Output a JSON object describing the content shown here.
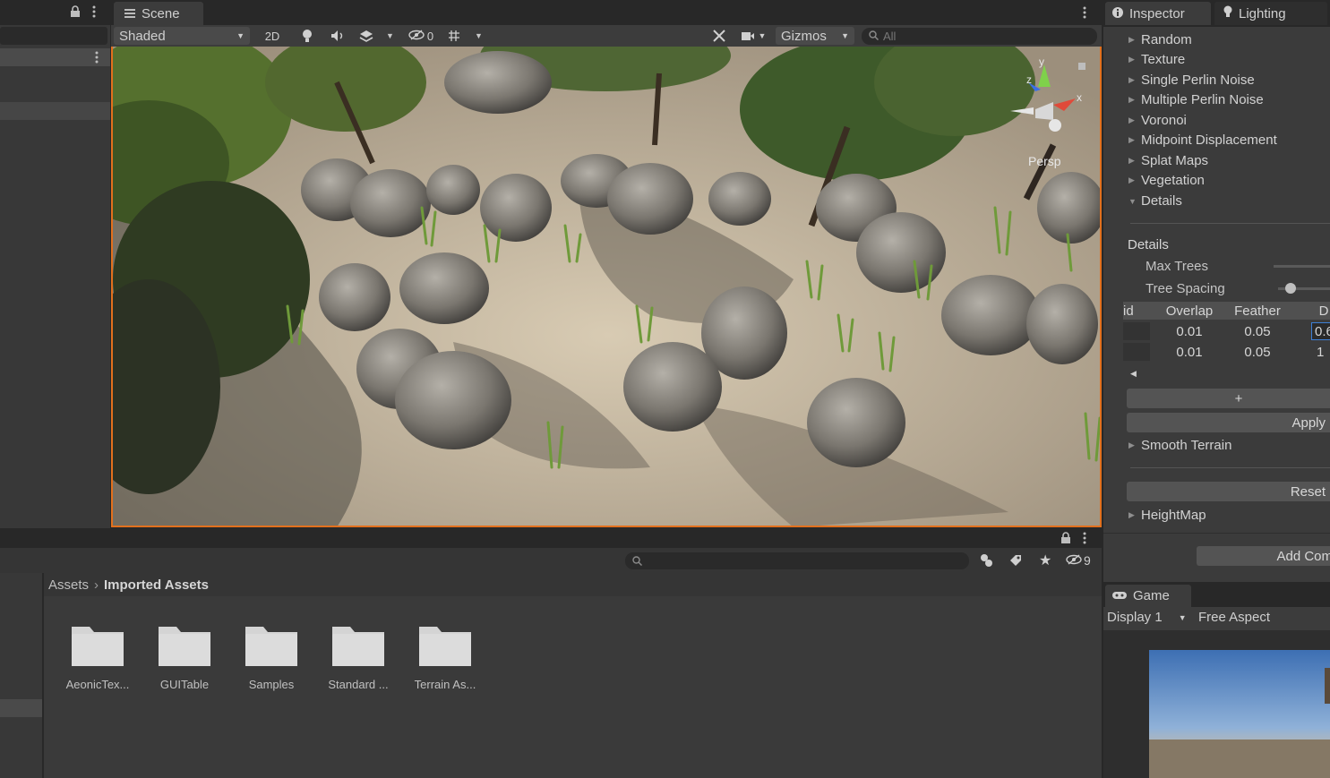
{
  "colors": {
    "accent": "#e2701d",
    "panel": "#383838",
    "toolbar": "#3c3c3c",
    "background": "#282828"
  },
  "icons": [
    "lock-icon",
    "more-icon",
    "scene-grid-icon",
    "light-icon",
    "audio-icon",
    "effects-icon",
    "hidden-icon",
    "grid-icon",
    "tools-icon",
    "camera-icon",
    "search-icon",
    "inspector-info-icon",
    "lighting-bulb-icon",
    "game-icon",
    "folder-icon",
    "label-icon",
    "star-icon",
    "gizmo-icon"
  ],
  "scene": {
    "tab": "Scene",
    "shading": "Shaded",
    "mode2d": "2D",
    "hidden_count": "0",
    "gizmos": "Gizmos",
    "search_placeholder": "All",
    "persp": "Persp",
    "axis_y": "y",
    "axis_x": "x",
    "axis_z": "z"
  },
  "inspector": {
    "tab": "Inspector",
    "lighting_tab": "Lighting",
    "sections": [
      "Random",
      "Texture",
      "Single Perlin Noise",
      "Multiple Perlin Noise",
      "Voronoi",
      "Midpoint Displacement",
      "Splat Maps",
      "Vegetation",
      "Details"
    ],
    "details_header": "Details",
    "max_trees": "Max Trees",
    "tree_spacing": "Tree Spacing",
    "tree_spacing_value": 0.1,
    "table": {
      "columns": [
        "id",
        "Overlap",
        "Feather",
        "D"
      ],
      "rows": [
        [
          "",
          "0.01",
          "0.05",
          "0.6"
        ],
        [
          "",
          "0.01",
          "0.05",
          "1"
        ]
      ]
    },
    "plus": "+",
    "apply": "Apply",
    "smooth_terrain": "Smooth Terrain",
    "reset": "Reset",
    "heightmap": "HeightMap",
    "add_component": "Add Com"
  },
  "project": {
    "hidden_count": "9",
    "breadcrumb": [
      "Assets",
      "Imported Assets"
    ],
    "folders": [
      "AeonicTex...",
      "GUITable",
      "Samples",
      "Standard ...",
      "Terrain As..."
    ]
  },
  "game": {
    "tab": "Game",
    "display": "Display 1",
    "aspect": "Free Aspect"
  }
}
